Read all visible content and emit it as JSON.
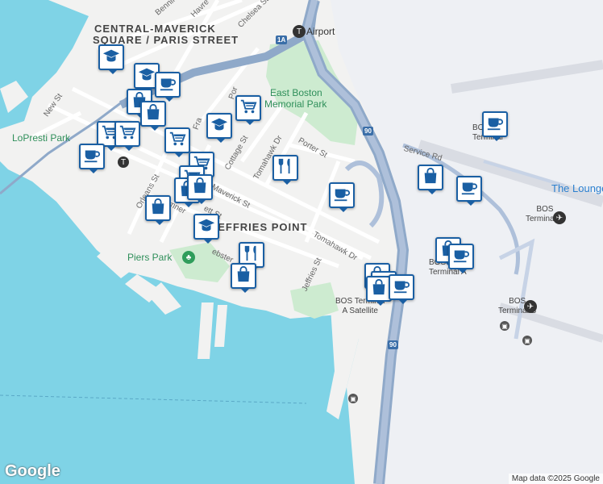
{
  "labels": {
    "neighborhood_1": "CENTRAL-MAVERICK",
    "neighborhood_2": "SQUARE / PARIS STREET",
    "airport": "Airport",
    "route_1a": "1A",
    "route_90": "90",
    "east_boston_park_1": "East Boston",
    "east_boston_park_2": "Memorial Park",
    "lopresti_park": "LoPresti Park",
    "jeffries_point": "JEFFRIES POINT",
    "piers_park": "Piers Park",
    "the_lounge": "The Lounge",
    "streets": {
      "new_st": "New St",
      "chelsea_st": "Chelsea St",
      "havre": "Havre",
      "bennington": "Benning",
      "porter_st": "Porter St",
      "tomahawk_dr_1": "Tomahawk Dr",
      "tomahawk_dr_2": "Tomahawk Dr",
      "cottage_st": "Cottage St",
      "maverick_st": "Maverick St",
      "orleans_st": "Orleans St",
      "jeffries_st": "Jeffries St",
      "service_rd": "Service Rd",
      "webster": "ebster",
      "sumner": "mner",
      "everett": "ett St",
      "frankfort": "Fra",
      "lexington": "ex",
      "por": "Por"
    },
    "terminals": {
      "terminal_b_top": "BOS\nTerminal",
      "terminal_c": "BOS\nTerminal C",
      "terminal_a": "BOS\nTerminal A",
      "terminal_b": "BOS\nTerminal B",
      "terminal_a_satellite": "BOS Terminal\nA Satellite"
    }
  },
  "pins": [
    {
      "type": "school",
      "name": "school-pin"
    },
    {
      "type": "school",
      "name": "school-pin"
    },
    {
      "type": "cafe",
      "name": "cafe-pin"
    },
    {
      "type": "shop",
      "name": "shopping-bag-pin"
    },
    {
      "type": "shop",
      "name": "shopping-bag-pin"
    },
    {
      "type": "grocery",
      "name": "grocery-cart-pin"
    },
    {
      "type": "school",
      "name": "school-pin"
    },
    {
      "type": "grocery",
      "name": "grocery-cart-pin"
    },
    {
      "type": "grocery",
      "name": "grocery-cart-pin"
    },
    {
      "type": "grocery",
      "name": "grocery-cart-pin"
    },
    {
      "type": "grocery",
      "name": "grocery-cart-pin"
    },
    {
      "type": "cafe",
      "name": "cafe-pin"
    },
    {
      "type": "grocery",
      "name": "grocery-cart-pin"
    },
    {
      "type": "shop",
      "name": "shopping-bag-pin"
    },
    {
      "type": "shop",
      "name": "shopping-bag-pin"
    },
    {
      "type": "shop",
      "name": "shopping-bag-pin"
    },
    {
      "type": "school",
      "name": "school-pin"
    },
    {
      "type": "restaurant",
      "name": "restaurant-pin"
    },
    {
      "type": "restaurant",
      "name": "restaurant-pin"
    },
    {
      "type": "shop",
      "name": "shopping-bag-pin"
    },
    {
      "type": "cafe",
      "name": "cafe-pin"
    },
    {
      "type": "shop",
      "name": "shopping-bag-pin"
    },
    {
      "type": "cafe",
      "name": "cafe-pin"
    },
    {
      "type": "cafe",
      "name": "cafe-pin"
    },
    {
      "type": "shop",
      "name": "shopping-bag-pin"
    },
    {
      "type": "cafe",
      "name": "cafe-pin"
    },
    {
      "type": "shop",
      "name": "shopping-bag-pin"
    },
    {
      "type": "cafe",
      "name": "cafe-pin"
    },
    {
      "type": "shop",
      "name": "shopping-bag-pin"
    },
    {
      "type": "cafe",
      "name": "cafe-pin"
    }
  ],
  "footer": {
    "logo": "Google",
    "attribution": "Map data ©2025 Google"
  }
}
